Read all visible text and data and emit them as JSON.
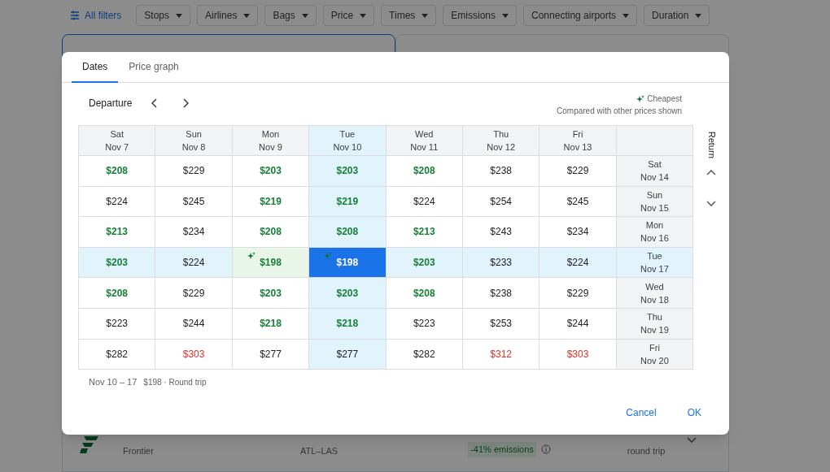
{
  "filters": {
    "all_filters": "All filters",
    "chips": [
      "Stops",
      "Airlines",
      "Bags",
      "Price",
      "Times",
      "Emissions",
      "Connecting airports",
      "Duration"
    ]
  },
  "sort_tabs": [
    {
      "selected": true
    },
    {
      "selected": false
    }
  ],
  "flight_row": {
    "airline": "Frontier",
    "route": "ATL–LAS",
    "emissions_badge": "-41% emissions",
    "trip_type": "round trip"
  },
  "dialog": {
    "tabs": [
      {
        "label": "Dates",
        "selected": true
      },
      {
        "label": "Price graph",
        "selected": false
      }
    ],
    "departure_label": "Departure",
    "legend": {
      "label": "Cheapest",
      "note": "Compared with other prices shown"
    },
    "return_label": "Return",
    "columns": [
      {
        "day": "Sat",
        "date": "Nov 7",
        "highlighted": false
      },
      {
        "day": "Sun",
        "date": "Nov 8",
        "highlighted": false
      },
      {
        "day": "Mon",
        "date": "Nov 9",
        "highlighted": false
      },
      {
        "day": "Tue",
        "date": "Nov 10",
        "highlighted": true
      },
      {
        "day": "Wed",
        "date": "Nov 11",
        "highlighted": false
      },
      {
        "day": "Thu",
        "date": "Nov 12",
        "highlighted": false
      },
      {
        "day": "Fri",
        "date": "Nov 13",
        "highlighted": false
      }
    ],
    "rows": [
      {
        "day": "Sat",
        "date": "Nov 14",
        "highlighted": false,
        "cells": [
          {
            "price": "$208",
            "cheap": true,
            "expensive": false,
            "cheapest": false,
            "selected": false
          },
          {
            "price": "$229",
            "cheap": false,
            "expensive": false,
            "cheapest": false,
            "selected": false
          },
          {
            "price": "$203",
            "cheap": true,
            "expensive": false,
            "cheapest": false,
            "selected": false
          },
          {
            "price": "$203",
            "cheap": true,
            "expensive": false,
            "cheapest": false,
            "selected": false
          },
          {
            "price": "$208",
            "cheap": true,
            "expensive": false,
            "cheapest": false,
            "selected": false
          },
          {
            "price": "$238",
            "cheap": false,
            "expensive": false,
            "cheapest": false,
            "selected": false
          },
          {
            "price": "$229",
            "cheap": false,
            "expensive": false,
            "cheapest": false,
            "selected": false
          }
        ]
      },
      {
        "day": "Sun",
        "date": "Nov 15",
        "highlighted": false,
        "cells": [
          {
            "price": "$224",
            "cheap": false,
            "expensive": false,
            "cheapest": false,
            "selected": false
          },
          {
            "price": "$245",
            "cheap": false,
            "expensive": false,
            "cheapest": false,
            "selected": false
          },
          {
            "price": "$219",
            "cheap": true,
            "expensive": false,
            "cheapest": false,
            "selected": false
          },
          {
            "price": "$219",
            "cheap": true,
            "expensive": false,
            "cheapest": false,
            "selected": false
          },
          {
            "price": "$224",
            "cheap": false,
            "expensive": false,
            "cheapest": false,
            "selected": false
          },
          {
            "price": "$254",
            "cheap": false,
            "expensive": false,
            "cheapest": false,
            "selected": false
          },
          {
            "price": "$245",
            "cheap": false,
            "expensive": false,
            "cheapest": false,
            "selected": false
          }
        ]
      },
      {
        "day": "Mon",
        "date": "Nov 16",
        "highlighted": false,
        "cells": [
          {
            "price": "$213",
            "cheap": true,
            "expensive": false,
            "cheapest": false,
            "selected": false
          },
          {
            "price": "$234",
            "cheap": false,
            "expensive": false,
            "cheapest": false,
            "selected": false
          },
          {
            "price": "$208",
            "cheap": true,
            "expensive": false,
            "cheapest": false,
            "selected": false
          },
          {
            "price": "$208",
            "cheap": true,
            "expensive": false,
            "cheapest": false,
            "selected": false
          },
          {
            "price": "$213",
            "cheap": true,
            "expensive": false,
            "cheapest": false,
            "selected": false
          },
          {
            "price": "$243",
            "cheap": false,
            "expensive": false,
            "cheapest": false,
            "selected": false
          },
          {
            "price": "$234",
            "cheap": false,
            "expensive": false,
            "cheapest": false,
            "selected": false
          }
        ]
      },
      {
        "day": "Tue",
        "date": "Nov 17",
        "highlighted": true,
        "cells": [
          {
            "price": "$203",
            "cheap": true,
            "expensive": false,
            "cheapest": false,
            "selected": false
          },
          {
            "price": "$224",
            "cheap": false,
            "expensive": false,
            "cheapest": false,
            "selected": false
          },
          {
            "price": "$198",
            "cheap": true,
            "expensive": false,
            "cheapest": true,
            "selected": false
          },
          {
            "price": "$198",
            "cheap": true,
            "expensive": false,
            "cheapest": true,
            "selected": true
          },
          {
            "price": "$203",
            "cheap": true,
            "expensive": false,
            "cheapest": false,
            "selected": false
          },
          {
            "price": "$233",
            "cheap": false,
            "expensive": false,
            "cheapest": false,
            "selected": false
          },
          {
            "price": "$224",
            "cheap": false,
            "expensive": false,
            "cheapest": false,
            "selected": false
          }
        ]
      },
      {
        "day": "Wed",
        "date": "Nov 18",
        "highlighted": false,
        "cells": [
          {
            "price": "$208",
            "cheap": true,
            "expensive": false,
            "cheapest": false,
            "selected": false
          },
          {
            "price": "$229",
            "cheap": false,
            "expensive": false,
            "cheapest": false,
            "selected": false
          },
          {
            "price": "$203",
            "cheap": true,
            "expensive": false,
            "cheapest": false,
            "selected": false
          },
          {
            "price": "$203",
            "cheap": true,
            "expensive": false,
            "cheapest": false,
            "selected": false
          },
          {
            "price": "$208",
            "cheap": true,
            "expensive": false,
            "cheapest": false,
            "selected": false
          },
          {
            "price": "$238",
            "cheap": false,
            "expensive": false,
            "cheapest": false,
            "selected": false
          },
          {
            "price": "$229",
            "cheap": false,
            "expensive": false,
            "cheapest": false,
            "selected": false
          }
        ]
      },
      {
        "day": "Thu",
        "date": "Nov 19",
        "highlighted": false,
        "cells": [
          {
            "price": "$223",
            "cheap": false,
            "expensive": false,
            "cheapest": false,
            "selected": false
          },
          {
            "price": "$244",
            "cheap": false,
            "expensive": false,
            "cheapest": false,
            "selected": false
          },
          {
            "price": "$218",
            "cheap": true,
            "expensive": false,
            "cheapest": false,
            "selected": false
          },
          {
            "price": "$218",
            "cheap": true,
            "expensive": false,
            "cheapest": false,
            "selected": false
          },
          {
            "price": "$223",
            "cheap": false,
            "expensive": false,
            "cheapest": false,
            "selected": false
          },
          {
            "price": "$253",
            "cheap": false,
            "expensive": false,
            "cheapest": false,
            "selected": false
          },
          {
            "price": "$244",
            "cheap": false,
            "expensive": false,
            "cheapest": false,
            "selected": false
          }
        ]
      },
      {
        "day": "Fri",
        "date": "Nov 20",
        "highlighted": false,
        "cells": [
          {
            "price": "$282",
            "cheap": false,
            "expensive": false,
            "cheapest": false,
            "selected": false
          },
          {
            "price": "$303",
            "cheap": false,
            "expensive": true,
            "cheapest": false,
            "selected": false
          },
          {
            "price": "$277",
            "cheap": false,
            "expensive": false,
            "cheapest": false,
            "selected": false
          },
          {
            "price": "$277",
            "cheap": false,
            "expensive": false,
            "cheapest": false,
            "selected": false
          },
          {
            "price": "$282",
            "cheap": false,
            "expensive": false,
            "cheapest": false,
            "selected": false
          },
          {
            "price": "$312",
            "cheap": false,
            "expensive": true,
            "cheapest": false,
            "selected": false
          },
          {
            "price": "$303",
            "cheap": false,
            "expensive": true,
            "cheapest": false,
            "selected": false
          }
        ]
      }
    ],
    "summary": {
      "dates": "Nov 10 – 17",
      "price": "$198 · Round trip"
    },
    "buttons": [
      "Cancel",
      "OK"
    ]
  }
}
